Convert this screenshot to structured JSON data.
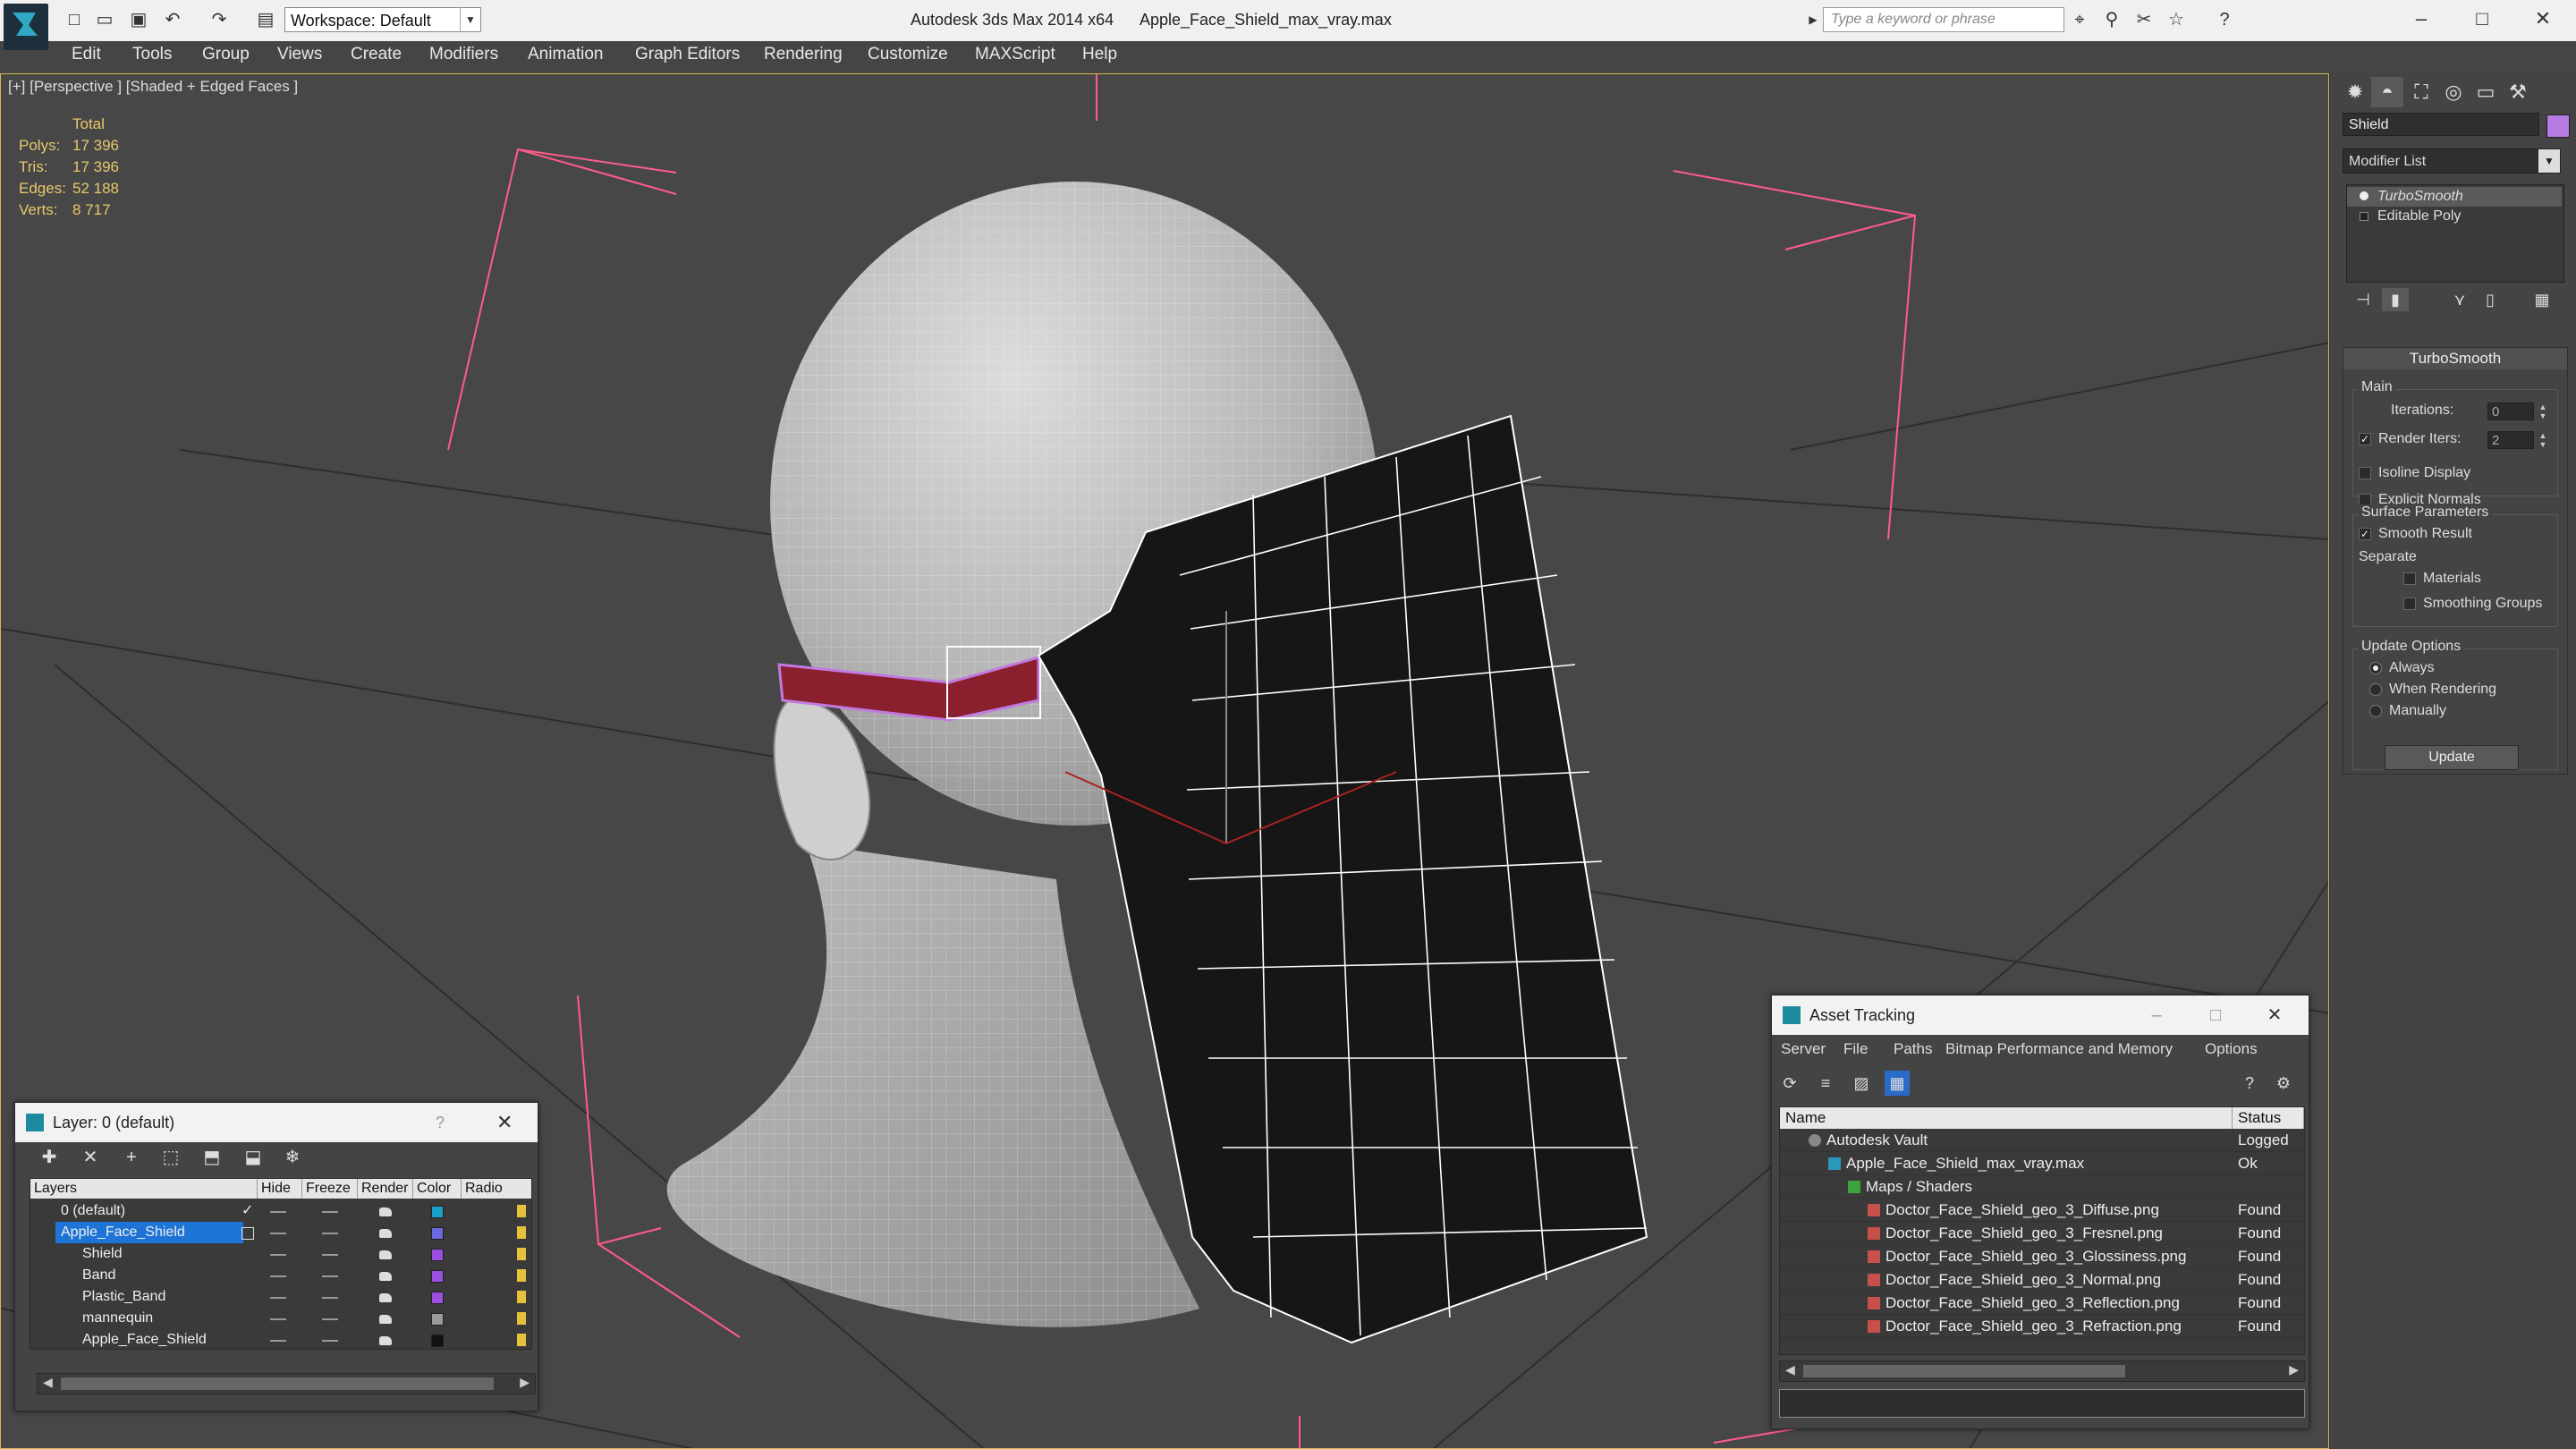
{
  "title_bar": {
    "app_title": "Autodesk 3ds Max 2014 x64",
    "file_name": "Apple_Face_Shield_max_vray.max",
    "workspace": "Workspace: Default",
    "search_placeholder": "Type a keyword or phrase"
  },
  "menu": [
    "Edit",
    "Tools",
    "Group",
    "Views",
    "Create",
    "Modifiers",
    "Animation",
    "Graph Editors",
    "Rendering",
    "Customize",
    "MAXScript",
    "Help"
  ],
  "viewport": {
    "label": "[+] [Perspective ] [Shaded + Edged Faces ]",
    "stats_header": "Total",
    "stats": [
      {
        "label": "Polys:",
        "value": "17 396"
      },
      {
        "label": "Tris:",
        "value": "17 396"
      },
      {
        "label": "Edges:",
        "value": "52 188"
      },
      {
        "label": "Verts:",
        "value": "8 717"
      }
    ]
  },
  "command_panel": {
    "object_name": "Shield",
    "object_color": "#b57be0",
    "modifier_list": "Modifier List",
    "stack": [
      "TurboSmooth",
      "Editable Poly"
    ],
    "rollout_title": "TurboSmooth",
    "main_group": "Main",
    "iterations_label": "Iterations:",
    "iterations_value": "0",
    "render_iters_label": "Render Iters:",
    "render_iters_value": "2",
    "isoline_label": "Isoline Display",
    "explicit_normals_label": "Explicit Normals",
    "surface_group": "Surface Parameters",
    "smooth_result_label": "Smooth Result",
    "separate_label": "Separate",
    "materials_label": "Materials",
    "smoothing_groups_label": "Smoothing Groups",
    "update_group": "Update Options",
    "always_label": "Always",
    "when_rendering_label": "When Rendering",
    "manually_label": "Manually",
    "update_button": "Update"
  },
  "layer_dialog": {
    "title": "Layer: 0 (default)",
    "help": "?",
    "columns": [
      "Layers",
      "Hide",
      "Freeze",
      "Render",
      "Color",
      "Radio"
    ],
    "rows": [
      {
        "name": "0 (default)",
        "color": "#1aa0c8"
      },
      {
        "name": "Apple_Face_Shield",
        "color": "#6a6ae0"
      },
      {
        "name": "Shield",
        "color": "#9b4fe0"
      },
      {
        "name": "Band",
        "color": "#9b4fe0"
      },
      {
        "name": "Plastic_Band",
        "color": "#9b4fe0"
      },
      {
        "name": "mannequin",
        "color": "#9a9a9a"
      },
      {
        "name": "Apple_Face_Shield",
        "color": "#111111"
      }
    ]
  },
  "asset_dialog": {
    "title": "Asset Tracking",
    "menu": [
      "Server",
      "File",
      "Paths",
      "Bitmap Performance and Memory",
      "Options"
    ],
    "columns": [
      "Name",
      "Status"
    ],
    "rows": [
      {
        "name": "Autodesk Vault",
        "status": "Logged"
      },
      {
        "name": "Apple_Face_Shield_max_vray.max",
        "status": "Ok"
      },
      {
        "name": "Maps / Shaders",
        "status": ""
      },
      {
        "name": "Doctor_Face_Shield_geo_3_Diffuse.png",
        "status": "Found"
      },
      {
        "name": "Doctor_Face_Shield_geo_3_Fresnel.png",
        "status": "Found"
      },
      {
        "name": "Doctor_Face_Shield_geo_3_Glossiness.png",
        "status": "Found"
      },
      {
        "name": "Doctor_Face_Shield_geo_3_Normal.png",
        "status": "Found"
      },
      {
        "name": "Doctor_Face_Shield_geo_3_Reflection.png",
        "status": "Found"
      },
      {
        "name": "Doctor_Face_Shield_geo_3_Refraction.png",
        "status": "Found"
      }
    ]
  }
}
